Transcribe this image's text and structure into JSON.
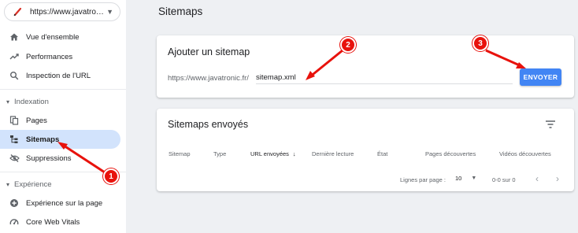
{
  "property": {
    "url": "https://www.javatro…",
    "icon": "pencil-logo-icon"
  },
  "sidebar": {
    "items": [
      {
        "label": "Vue d'ensemble",
        "icon": "home-icon"
      },
      {
        "label": "Performances",
        "icon": "trending-icon"
      },
      {
        "label": "Inspection de l'URL",
        "icon": "search-icon"
      }
    ],
    "section_indexation": "Indexation",
    "indexation_items": [
      {
        "label": "Pages",
        "icon": "pages-icon"
      },
      {
        "label": "Sitemaps",
        "icon": "sitemap-icon",
        "active": true
      },
      {
        "label": "Suppressions",
        "icon": "removal-icon"
      }
    ],
    "section_experience": "Expérience",
    "experience_items": [
      {
        "label": "Expérience sur la page",
        "icon": "add-circle-icon"
      },
      {
        "label": "Core Web Vitals",
        "icon": "speed-icon"
      }
    ]
  },
  "main": {
    "title": "Sitemaps",
    "add_card": {
      "title": "Ajouter un sitemap",
      "url_prefix": "https://www.javatronic.fr/",
      "input_value": "sitemap.xml",
      "submit_label": "ENVOYER"
    },
    "sent_card": {
      "title": "Sitemaps envoyés",
      "columns": [
        "Sitemap",
        "Type",
        "URL envoyées",
        "Dernière lecture",
        "État",
        "Pages découvertes",
        "Vidéos découvertes"
      ],
      "sorted_column": "URL envoyées",
      "rows_per_page_label": "Lignes par page :",
      "rows_per_page_value": "10",
      "range": "0-0 sur 0"
    }
  },
  "annotations": [
    "1",
    "2",
    "3"
  ],
  "colors": {
    "accent": "#4285f4",
    "active_nav": "#d2e3fc",
    "annotation": "#e8120c"
  }
}
